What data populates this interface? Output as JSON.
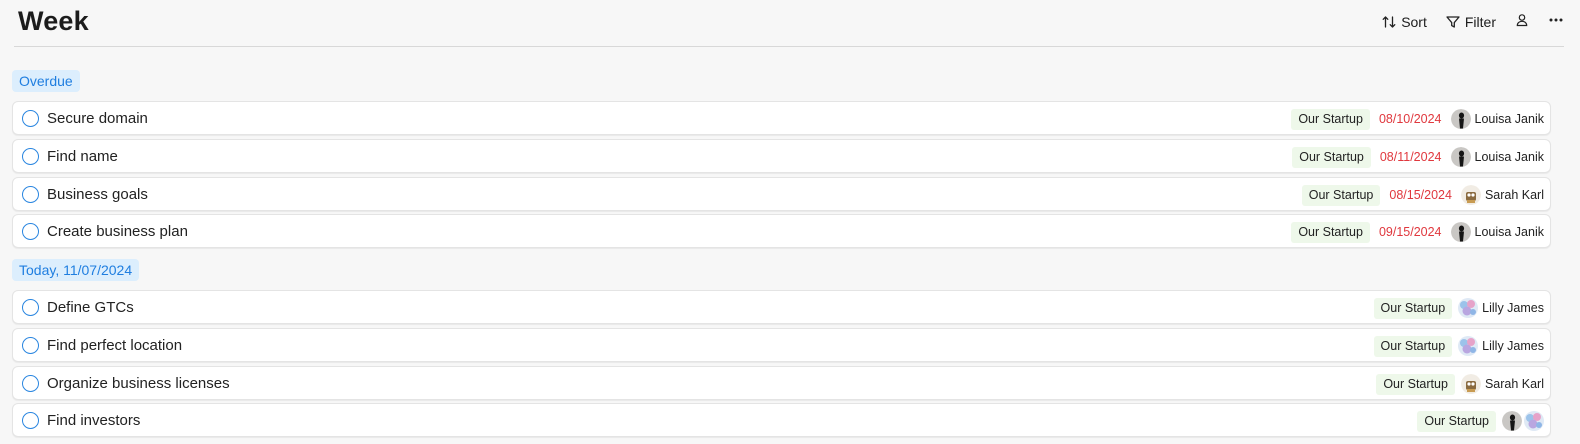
{
  "header": {
    "title": "Week",
    "sort_label": "Sort",
    "filter_label": "Filter"
  },
  "groups": [
    {
      "label": "Overdue",
      "tasks": [
        {
          "title": "Secure domain",
          "project": "Our Startup",
          "due": "08/10/2024",
          "assignee": "Louisa Janik"
        },
        {
          "title": "Find name",
          "project": "Our Startup",
          "due": "08/11/2024",
          "assignee": "Louisa Janik"
        },
        {
          "title": "Business goals",
          "project": "Our Startup",
          "due": "08/15/2024",
          "assignee": "Sarah Karl"
        },
        {
          "title": "Create business plan",
          "project": "Our Startup",
          "due": "09/15/2024",
          "assignee": "Louisa Janik"
        }
      ]
    },
    {
      "label": "Today, 11/07/2024",
      "tasks": [
        {
          "title": "Define GTCs",
          "project": "Our Startup",
          "assignee": "Lilly James"
        },
        {
          "title": "Find perfect location",
          "project": "Our Startup",
          "assignee": "Lilly James"
        },
        {
          "title": "Organize business licenses",
          "project": "Our Startup",
          "assignee": "Sarah Karl"
        },
        {
          "title": "Find investors",
          "project": "Our Startup",
          "assignee": ""
        }
      ]
    }
  ],
  "colors": {
    "accent": "#2a86e0",
    "group_badge_bg": "#dceefd",
    "group_badge_text": "#1f7ee0",
    "overdue_date": "#e0383e",
    "project_tag_bg": "#eef8ea"
  },
  "icons": [
    "sort-icon",
    "filter-icon",
    "person-icon",
    "more-icon",
    "checkbox-circle-icon",
    "avatar"
  ]
}
